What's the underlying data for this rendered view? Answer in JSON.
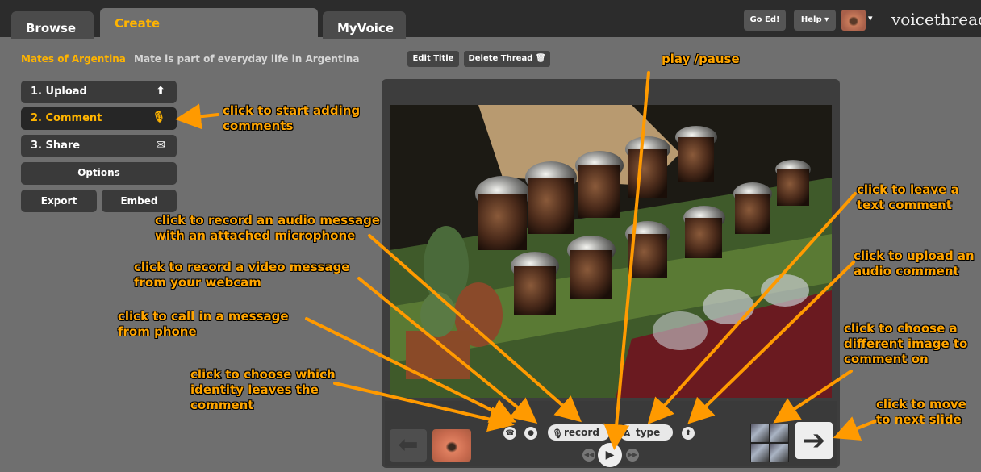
{
  "tabs": {
    "browse": "Browse",
    "create": "Create",
    "myvoice": "MyVoice"
  },
  "header": {
    "go_ed": "Go Ed!",
    "help": "Help ▾",
    "logo": "voicethread",
    "avatar_caret": "▾"
  },
  "thread": {
    "name": "Mates of Argentina",
    "description": "Mate is part of everyday life in Argentina",
    "edit_title": "Edit Title",
    "delete_thread": "Delete Thread 🗑"
  },
  "sidebar": {
    "items": [
      {
        "label": "1. Upload",
        "icon": "upload-icon",
        "glyph": "⬆"
      },
      {
        "label": "2. Comment",
        "icon": "microphone-icon",
        "glyph": "🎙"
      },
      {
        "label": "3. Share",
        "icon": "envelope-icon",
        "glyph": "✉"
      }
    ],
    "options": "Options",
    "export": "Export",
    "embed": "Embed"
  },
  "controls": {
    "record": "record",
    "type": "type",
    "phone_glyph": "☎",
    "webcam_glyph": "●",
    "upload_glyph": "⬆",
    "play_glyph": "▶",
    "prev_glyph": "◀◀",
    "next_seek_glyph": "▶▶",
    "back_glyph": "⬅",
    "next_glyph": "➔"
  },
  "annotations": {
    "play_pause": "play /pause",
    "start_comments_1": "click to start adding",
    "start_comments_2": "comments",
    "text_comment_1": "click to leave a",
    "text_comment_2": "text comment",
    "audio_mic_1": "click to record an audio message",
    "audio_mic_2": "with an attached microphone",
    "upload_audio_1": "click to upload an",
    "upload_audio_2": "audio comment",
    "video_1": "click to record a video message",
    "video_2": "from your webcam",
    "phone_1": "click to call in a message",
    "phone_2": "from phone",
    "diff_image_1": "click to choose a",
    "diff_image_2": "different image to",
    "diff_image_3": "comment on",
    "identity_1": "click to choose which",
    "identity_2": "identity leaves the",
    "identity_3": "comment",
    "next_slide_1": "click to move",
    "next_slide_2": "to next slide"
  },
  "colors": {
    "accent": "#ffb400",
    "annotation": "#ffa500",
    "background": "#6f6f6f",
    "topbar": "#2c2c2c"
  }
}
